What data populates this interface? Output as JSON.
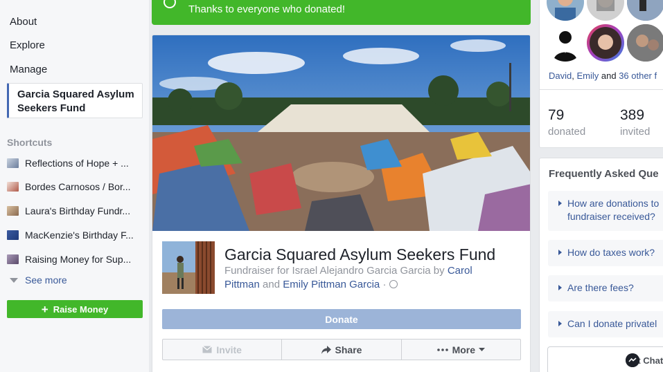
{
  "left_nav": {
    "items": [
      "About",
      "Explore",
      "Manage"
    ],
    "active": "Garcia Squared Asylum Seekers Fund"
  },
  "shortcuts": {
    "heading": "Shortcuts",
    "items": [
      {
        "label": "Reflections of Hope + ...",
        "color": "#6b7d9c"
      },
      {
        "label": "Bordes Carnosos / Bor...",
        "color": "#b05a4a"
      },
      {
        "label": "Laura's Birthday Fundr...",
        "color": "#8a6a50"
      },
      {
        "label": "MacKenzie's Birthday F...",
        "color": "#1f3a7a"
      },
      {
        "label": "Raising Money for Sup...",
        "color": "#5a4a6a"
      }
    ],
    "see_more": "See more"
  },
  "raise_money_label": "Raise Money",
  "banner": {
    "text": "Thanks to everyone who donated!",
    "color": "#42b72a"
  },
  "fundraiser": {
    "title": "Garcia Squared Asylum Seekers Fund",
    "sub_prefix": "Fundraiser for Israel Alejandro Garcia Garcia by ",
    "organizer_1": "Carol Pittman",
    "conj": " and ",
    "organizer_2": "Emily Pittman Garcia",
    "dot": " · ",
    "privacy_icon": "globe-icon"
  },
  "actions": {
    "donate": "Donate",
    "invite": "Invite",
    "share": "Share",
    "more": "More"
  },
  "donors": {
    "names_1": "David",
    "sep": ", ",
    "names_2": "Emily",
    "and": " and ",
    "others": "36 other f"
  },
  "stats": {
    "donated_count": "79",
    "donated_label": "donated",
    "invited_count": "389",
    "invited_label": "invited"
  },
  "faq": {
    "heading": "Frequently Asked Que",
    "items": [
      "How are donations to fundraiser received?",
      "How do taxes work?",
      "Are there fees?",
      "Can I donate privatel"
    ]
  },
  "chat": {
    "label": "Get Chat"
  },
  "colors": {
    "accent": "#4267b2",
    "link": "#385898",
    "green": "#42b72a",
    "donate_disabled": "#9cb4d8"
  }
}
